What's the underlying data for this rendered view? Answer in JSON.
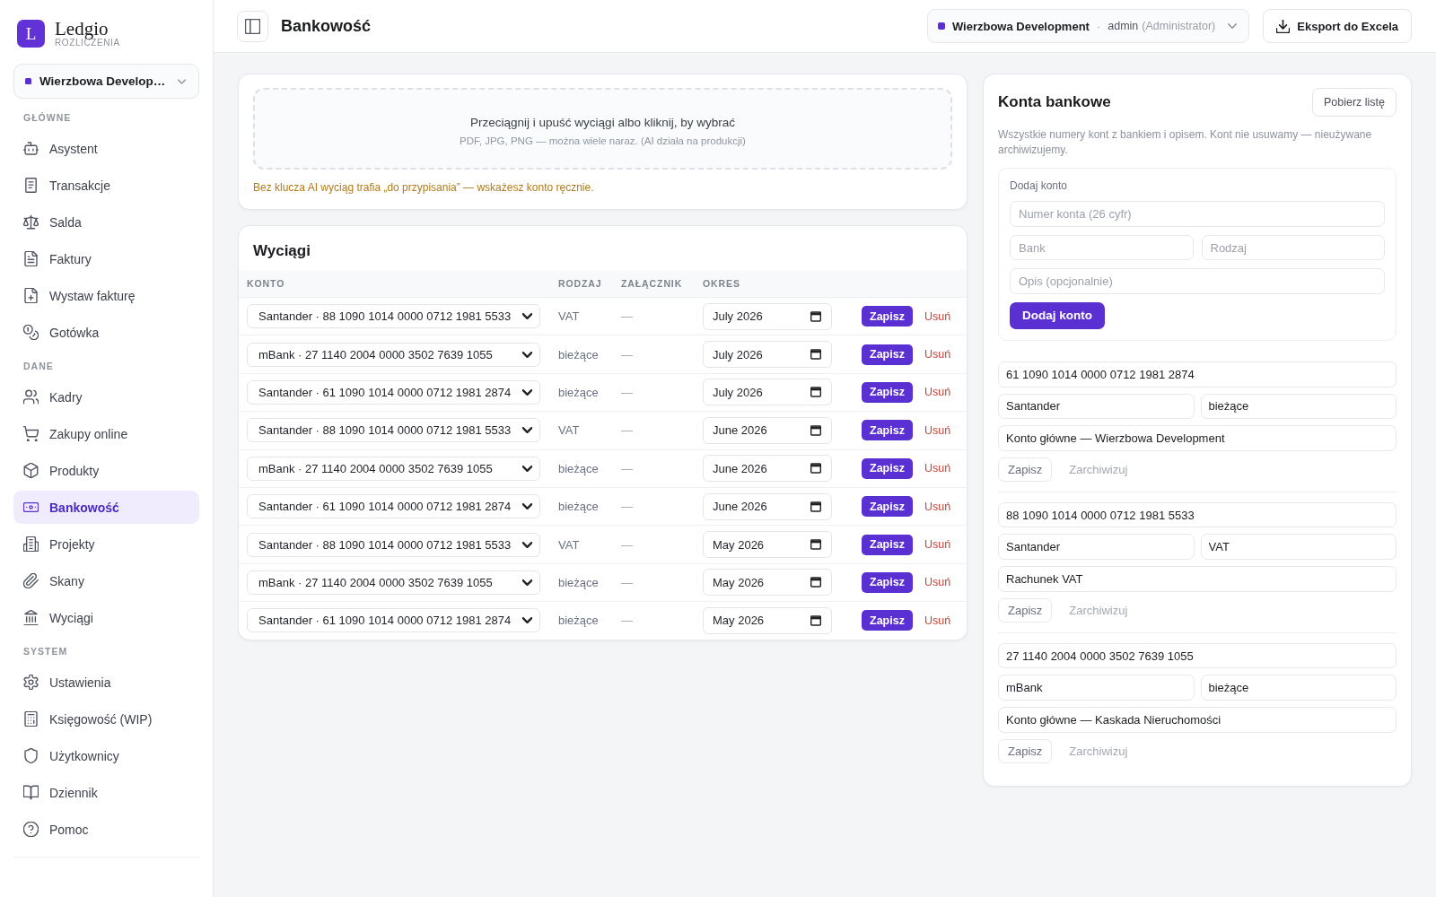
{
  "sidebar": {
    "logo": {
      "letter": "L",
      "name": "Ledgio",
      "subtitle": "ROZLICZENIA"
    },
    "organization": "Wierzbowa Develop…",
    "sections": [
      {
        "title": "GŁÓWNE",
        "items": [
          {
            "label": "Asystent",
            "selected": false
          },
          {
            "label": "Transakcje",
            "selected": false
          },
          {
            "label": "Salda",
            "selected": false
          },
          {
            "label": "Faktury",
            "selected": false
          },
          {
            "label": "Wystaw fakturę",
            "selected": false
          },
          {
            "label": "Gotówka",
            "selected": false
          }
        ]
      },
      {
        "title": "DANE",
        "items": [
          {
            "label": "Kadry",
            "selected": false
          },
          {
            "label": "Zakupy online",
            "selected": false
          },
          {
            "label": "Produkty",
            "selected": false
          },
          {
            "label": "Bankowość",
            "selected": true
          },
          {
            "label": "Projekty",
            "selected": false
          },
          {
            "label": "Skany",
            "selected": false
          },
          {
            "label": "Wyciągi",
            "selected": false
          }
        ]
      },
      {
        "title": "SYSTEM",
        "items": [
          {
            "label": "Ustawienia",
            "selected": false
          },
          {
            "label": "Księgowość (WIP)",
            "selected": false
          },
          {
            "label": "Użytkownicy",
            "selected": false
          },
          {
            "label": "Dziennik",
            "selected": false
          },
          {
            "label": "Pomoc",
            "selected": false
          }
        ]
      }
    ]
  },
  "topbar": {
    "title": "Bankowość",
    "organization": "Wierzbowa Development",
    "separator": "·",
    "user": "admin",
    "role": "(Administrator)",
    "export_button": "Eksport do Excela"
  },
  "upload": {
    "dropzone_title": "Przeciągnij i upuść wyciągi albo kliknij, by wybrać",
    "dropzone_hint": "PDF, JPG, PNG — można wiele naraz. (AI działa na produkcji)",
    "notice": "Bez klucza AI wyciąg trafia „do przypisania” — wskażesz konto ręcznie."
  },
  "statements": {
    "title": "Wyciągi",
    "columns": [
      "KONTO",
      "RODZAJ",
      "ZAŁĄCZNIK",
      "OKRES"
    ],
    "rows": [
      {
        "account": "Santander · 88 1090 1014 0000 0712 1981 5533",
        "type": "VAT",
        "attachment": "—",
        "period": "July 2026",
        "save": "Zapisz",
        "delete": "Usuń"
      },
      {
        "account": "mBank · 27 1140 2004 0000 3502 7639 1055",
        "type": "bieżące",
        "attachment": "—",
        "period": "July 2026",
        "save": "Zapisz",
        "delete": "Usuń"
      },
      {
        "account": "Santander · 61 1090 1014 0000 0712 1981 2874",
        "type": "bieżące",
        "attachment": "—",
        "period": "July 2026",
        "save": "Zapisz",
        "delete": "Usuń"
      },
      {
        "account": "Santander · 88 1090 1014 0000 0712 1981 5533",
        "type": "VAT",
        "attachment": "—",
        "period": "June 2026",
        "save": "Zapisz",
        "delete": "Usuń"
      },
      {
        "account": "mBank · 27 1140 2004 0000 3502 7639 1055",
        "type": "bieżące",
        "attachment": "—",
        "period": "June 2026",
        "save": "Zapisz",
        "delete": "Usuń"
      },
      {
        "account": "Santander · 61 1090 1014 0000 0712 1981 2874",
        "type": "bieżące",
        "attachment": "—",
        "period": "June 2026",
        "save": "Zapisz",
        "delete": "Usuń"
      },
      {
        "account": "Santander · 88 1090 1014 0000 0712 1981 5533",
        "type": "VAT",
        "attachment": "—",
        "period": "May 2026",
        "save": "Zapisz",
        "delete": "Usuń"
      },
      {
        "account": "mBank · 27 1140 2004 0000 3502 7639 1055",
        "type": "bieżące",
        "attachment": "—",
        "period": "May 2026",
        "save": "Zapisz",
        "delete": "Usuń"
      },
      {
        "account": "Santander · 61 1090 1014 0000 0712 1981 2874",
        "type": "bieżące",
        "attachment": "—",
        "period": "May 2026",
        "save": "Zapisz",
        "delete": "Usuń"
      }
    ]
  },
  "bank_accounts": {
    "title": "Konta bankowe",
    "download_button": "Pobierz listę",
    "description": "Wszystkie numery kont z bankiem i opisem. Kont nie usuwamy — nieużywane archiwizujemy.",
    "add_form": {
      "title": "Dodaj konto",
      "number": {
        "placeholder": "Numer konta (26 cyfr)"
      },
      "bank": {
        "placeholder": "Bank"
      },
      "type": {
        "placeholder": "Rodzaj"
      },
      "description": {
        "placeholder": "Opis (opcjonalnie)"
      },
      "button": "Dodaj konto"
    },
    "accounts": [
      {
        "number": "61 1090 1014 0000 0712 1981 2874",
        "bank": "Santander",
        "type": "bieżące",
        "description": "Konto główne — Wierzbowa Development",
        "save": "Zapisz",
        "archive": "Zarchiwizuj"
      },
      {
        "number": "88 1090 1014 0000 0712 1981 5533",
        "bank": "Santander",
        "type": "VAT",
        "description": "Rachunek VAT",
        "save": "Zapisz",
        "archive": "Zarchiwizuj"
      },
      {
        "number": "27 1140 2004 0000 3502 7639 1055",
        "bank": "mBank",
        "type": "bieżące",
        "description": "Konto główne — Kaskada Nieruchomości",
        "save": "Zapisz",
        "archive": "Zarchiwizuj"
      }
    ]
  }
}
